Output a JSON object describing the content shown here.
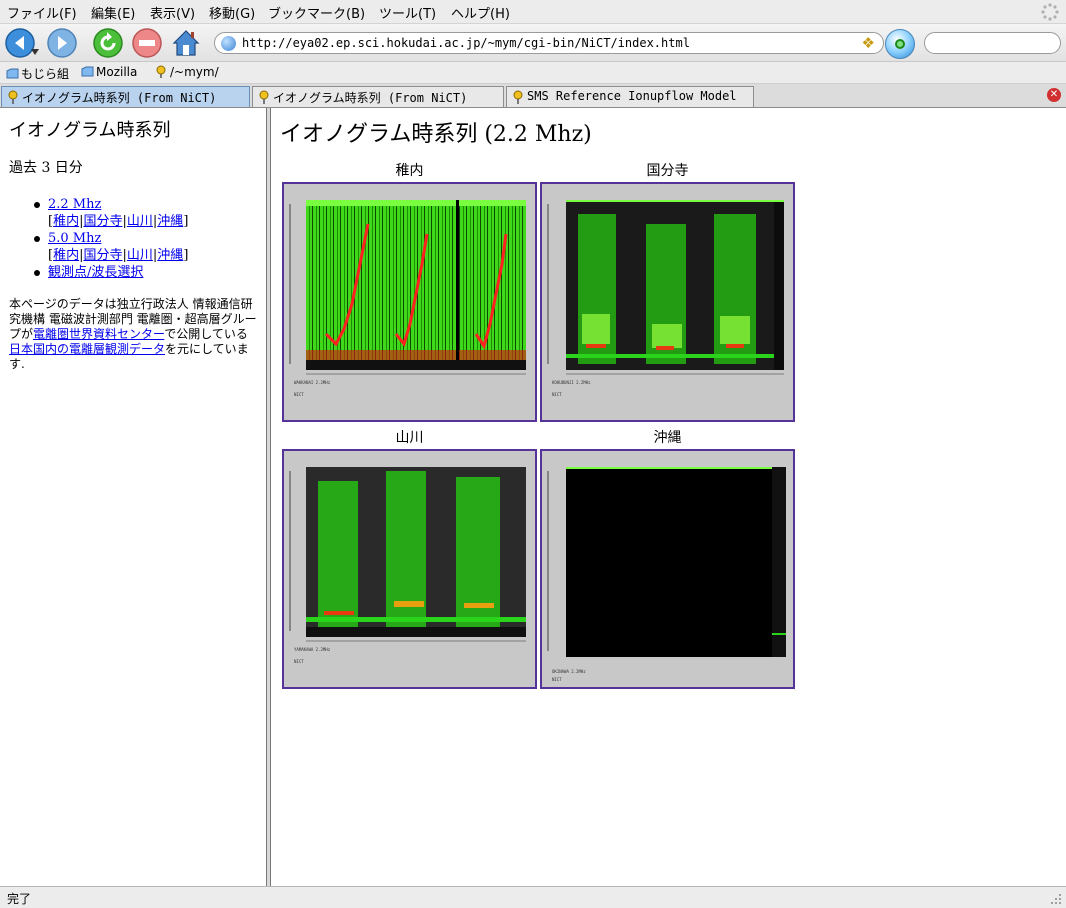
{
  "menu": [
    "ファイル(F)",
    "編集(E)",
    "表示(V)",
    "移動(G)",
    "ブックマーク(B)",
    "ツール(T)",
    "ヘルプ(H)"
  ],
  "url": "http://eya02.ep.sci.hokudai.ac.jp/~mym/cgi-bin/NiCT/index.html",
  "bookmarks": [
    "もじら組",
    "Mozilla",
    "/~mym/"
  ],
  "tabs": [
    "イオノグラム時系列 (From NiCT)",
    "イオノグラム時系列 (From NiCT)",
    "SMS Reference Ionupflow Model"
  ],
  "left": {
    "title": "イオノグラム時系列",
    "period": "過去 3 日分",
    "freq1": {
      "label": "2.2 Mhz",
      "stations": [
        "稚内",
        "国分寺",
        "山川",
        "沖縄"
      ]
    },
    "freq2": {
      "label": "5.0 Mhz",
      "stations": [
        "稚内",
        "国分寺",
        "山川",
        "沖縄"
      ]
    },
    "select_link": "観測点/波長選択",
    "desc": {
      "part1": "本ページのデータは独立行政法人 情報通信研究機構 電磁波計測部門 電離圏・超高層グループが",
      "link1": "電離圏世界資料センター",
      "part2": "で公開している ",
      "link2": "日本国内の電離層観測データ",
      "part3": "を元にしています."
    }
  },
  "main": {
    "title": "イオノグラム時系列 (2.2 Mhz)",
    "stations": [
      "稚内",
      "国分寺",
      "山川",
      "沖縄"
    ]
  },
  "colors": {
    "plot_frame": "#553399",
    "link": "#0000ee",
    "active_tab": "#b9d3ef"
  },
  "status": "完了"
}
